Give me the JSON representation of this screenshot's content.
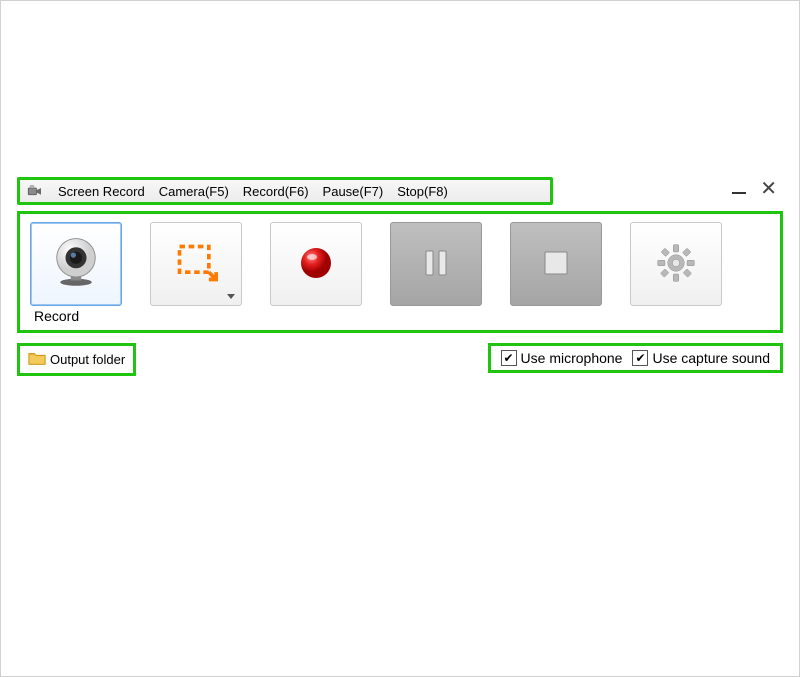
{
  "menu": {
    "title": "Screen Record",
    "items": [
      "Camera(F5)",
      "Record(F6)",
      "Pause(F7)",
      "Stop(F8)"
    ]
  },
  "toolbar": {
    "label": "Record"
  },
  "footer": {
    "output_folder_label": "Output folder",
    "use_microphone_label": "Use microphone",
    "use_capture_sound_label": "Use capture sound",
    "use_microphone_checked": true,
    "use_capture_sound_checked": true
  },
  "highlight_color": "#1fc40e"
}
